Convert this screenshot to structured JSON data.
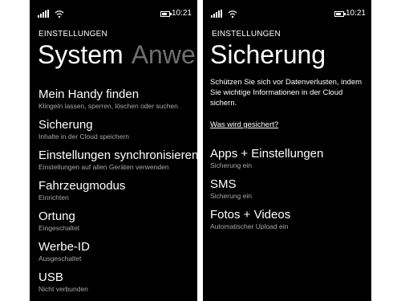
{
  "left_screen": {
    "status_time": "10:21",
    "app_title": "EINSTELLUNGEN",
    "pivot_active": "System",
    "pivot_inactive": "Anwen",
    "items": [
      {
        "title": "Mein Handy finden",
        "sub": "Klingeln lassen, sperren, löschen oder suchen"
      },
      {
        "title": "Sicherung",
        "sub": "Inhalte in der Cloud speichern"
      },
      {
        "title": "Einstellungen synchronisieren",
        "sub": "Einstellungen auf allen Geräten verwenden"
      },
      {
        "title": "Fahrzeugmodus",
        "sub": "Einrichten"
      },
      {
        "title": "Ortung",
        "sub": "Eingeschaltet"
      },
      {
        "title": "Werbe-ID",
        "sub": "Ausgeschaltet"
      },
      {
        "title": "USB",
        "sub": "Nicht verbunden"
      }
    ]
  },
  "right_screen": {
    "status_time": "10:21",
    "app_title": "EINSTELLUNGEN",
    "page_title": "Sicherung",
    "description": "Schützen Sie sich vor Datenverlusten, indem Sie wichtige Informationen in der Cloud sichern.",
    "link": "Was wird gesichert?",
    "items": [
      {
        "title": "Apps + Einstellungen",
        "sub": "Sicherung ein"
      },
      {
        "title": "SMS",
        "sub": "Sicherung ein"
      },
      {
        "title": "Fotos + Videos",
        "sub": "Automatischer Upload ein"
      }
    ]
  },
  "icons": [
    "signal-icon",
    "wifi-icon",
    "battery-icon"
  ],
  "colors": {
    "background": "#000000",
    "text": "#ffffff",
    "secondary_text": "#a8a8a8",
    "inactive_pivot": "#6f6f6f",
    "frame": "#ffffff"
  }
}
